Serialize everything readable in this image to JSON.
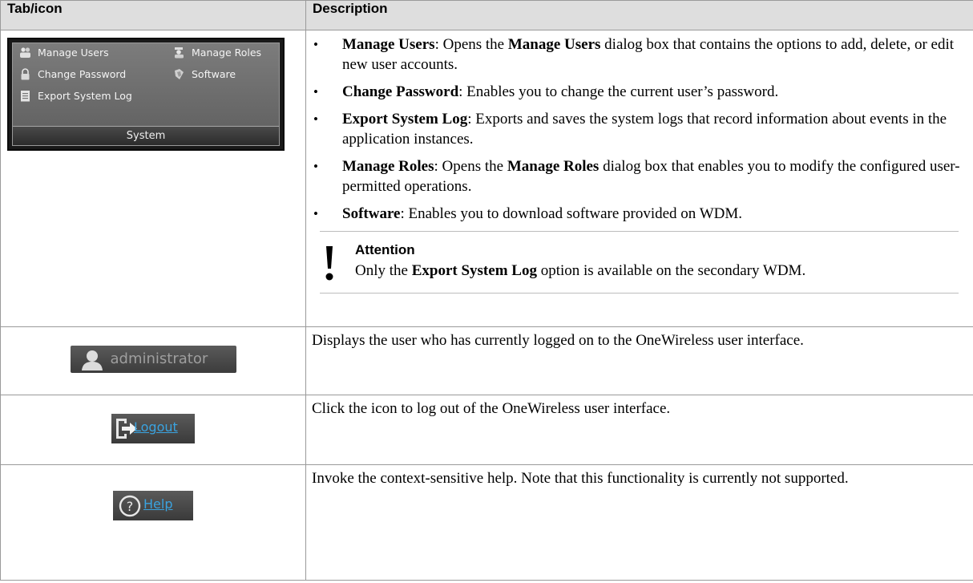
{
  "table": {
    "header": {
      "col1": "Tab/icon",
      "col2": "Description"
    }
  },
  "system_panel": {
    "items": {
      "manage_users": "Manage Users",
      "manage_roles": "Manage Roles",
      "change_password": "Change Password",
      "software": "Software",
      "export_system_log": "Export System Log"
    },
    "footer": "System"
  },
  "system_desc": [
    {
      "term": "Manage Users",
      "t1": ": Opens the ",
      "bold2": "Manage Users",
      "t2": " dialog box that contains the options to add, delete, or edit new user accounts."
    },
    {
      "term": "Change Password",
      "t1": ": Enables you to change the current user’s password."
    },
    {
      "term": "Export System Log",
      "t1": ": Exports and saves the system logs that record information about events in the application instances."
    },
    {
      "term": "Manage Roles",
      "t1": ": Opens the ",
      "bold2": "Manage Roles",
      "t2": " dialog box that enables you to modify the configured user-permitted operations."
    },
    {
      "term": "Software",
      "t1": ": Enables you to download software provided on WDM."
    }
  ],
  "attention": {
    "title": "Attention",
    "pre": "Only the ",
    "bold": "Export System Log",
    "post": " option is available on the secondary WDM."
  },
  "user_badge": {
    "text": "administrator"
  },
  "user_desc": "Displays the user who has currently logged on to the OneWireless user interface.",
  "logout_icon": {
    "text": "Logout"
  },
  "logout_desc": "Click the icon to log out of the OneWireless user interface.",
  "help_icon": {
    "text": "Help"
  },
  "help_desc": "Invoke the context-sensitive help. Note that this functionality is currently not supported.",
  "colors": {
    "header_bg": "#dedede",
    "link": "#3aa3e0",
    "panel_bg": "#6e6e6e"
  }
}
